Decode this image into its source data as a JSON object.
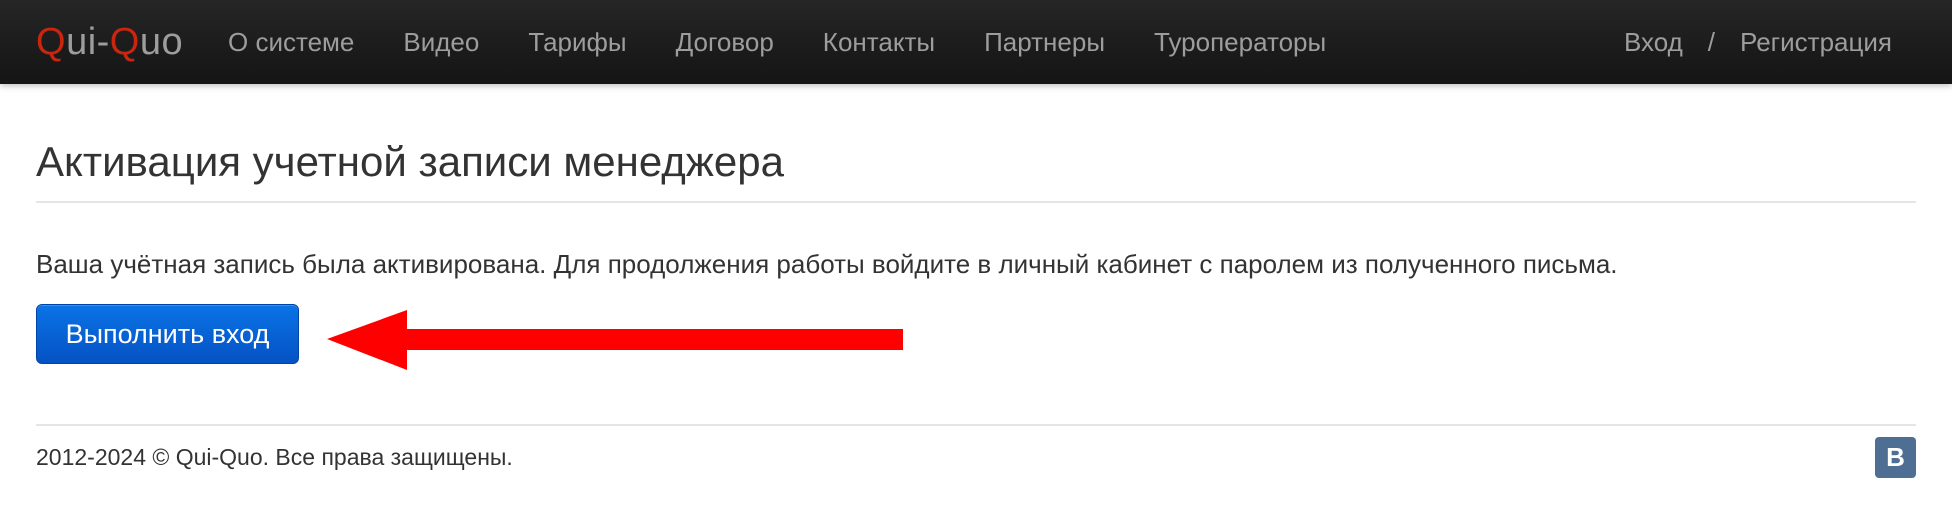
{
  "navbar": {
    "brand": {
      "q1": "Q",
      "part1": "ui-",
      "q2": "Q",
      "part2": "uo"
    },
    "links": [
      "О системе",
      "Видео",
      "Тарифы",
      "Договор",
      "Контакты",
      "Партнеры",
      "Туроператоры"
    ],
    "login": "Вход",
    "separator": "/",
    "register": "Регистрация"
  },
  "main": {
    "title": "Активация учетной записи менеджера",
    "message": "Ваша учётная запись была активирована. Для продолжения работы войдите в личный кабинет с паролем из полученного письма.",
    "login_button": "Выполнить вход"
  },
  "footer": {
    "copyright": "2012-2024 © Qui-Quo. Все права защищены.",
    "vk_label": "B"
  },
  "colors": {
    "brand_q": "#c9250f",
    "navbar_bg": "#1b1b1b",
    "button_blue": "#0552c4",
    "arrow_red": "#ff0000",
    "vk_bg": "#4e6f93"
  }
}
